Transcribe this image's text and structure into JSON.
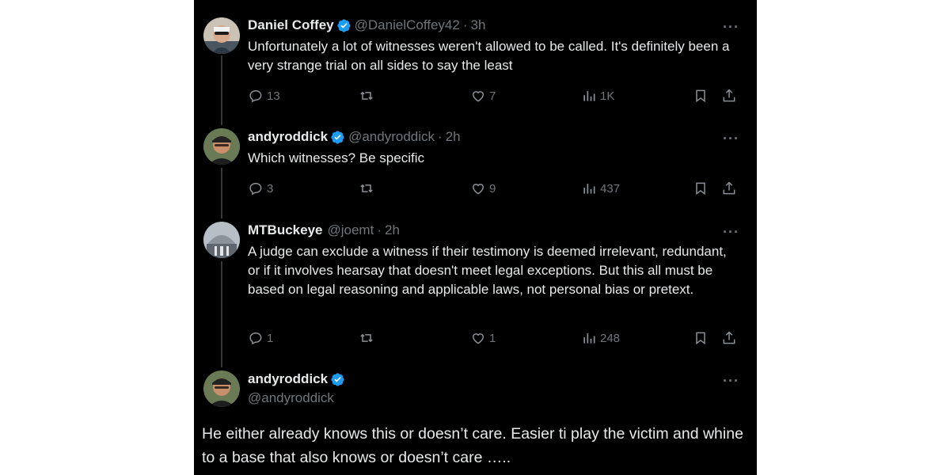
{
  "tweets": [
    {
      "name": "Daniel Coffey",
      "handle": "@DanielCoffey42",
      "time": "3h",
      "text": "Unfortunately a lot of witnesses weren't allowed to be called. It's definitely been a very strange trial on all sides to say the least",
      "replies": "13",
      "likes": "7",
      "views": "1K"
    },
    {
      "name": "andyroddick",
      "handle": "@andyroddick",
      "time": "2h",
      "text": "Which witnesses?  Be specific",
      "replies": "3",
      "likes": "9",
      "views": "437"
    },
    {
      "name": "MTBuckeye",
      "handle": "@joemt",
      "time": "2h",
      "text": "A judge can exclude a witness if their testimony is deemed irrelevant, redundant, or if it involves hearsay that doesn't meet legal exceptions. But this all must be based on legal reasoning and applicable laws, not personal bias or pretext.",
      "replies": "1",
      "likes": "1",
      "views": "248"
    }
  ],
  "main_tweet": {
    "name": "andyroddick",
    "handle": "@andyroddick",
    "text": "He either already knows this or doesn’t care.  Easier ti play the victim and whine to a base that also knows or doesn’t care ….."
  },
  "separator": "·",
  "more_label": "···",
  "colors": {
    "background": "#000000",
    "text": "#e7e9ea",
    "secondary": "#71767b",
    "verified": "#1d9bf0",
    "thread_line": "#333639"
  },
  "icons": [
    "reply-icon",
    "retweet-icon",
    "like-icon",
    "views-icon",
    "bookmark-icon",
    "share-icon",
    "verified-badge-icon",
    "more-icon"
  ]
}
